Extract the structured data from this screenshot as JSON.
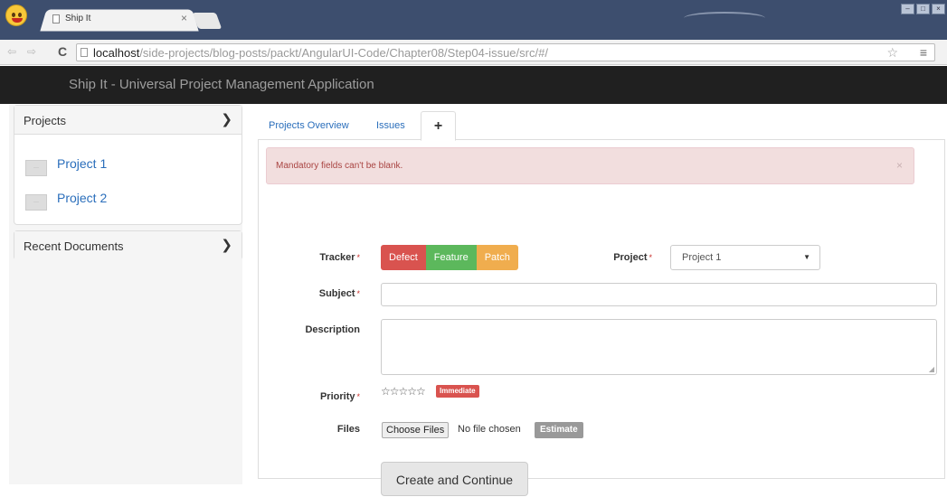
{
  "browser": {
    "tab_title": "Ship It",
    "tab_close": "×",
    "url_host": "localhost",
    "url_path": "/side-projects/blog-posts/packt/AngularUI-Code/Chapter08/Step04-issue/src/#/",
    "window_controls": [
      "–",
      "□",
      "×"
    ]
  },
  "app": {
    "brand": "Ship It - Universal Project Management Application"
  },
  "sidebar": {
    "projects_header": "Projects",
    "projects": [
      {
        "name": "Project 1"
      },
      {
        "name": "Project 2"
      }
    ],
    "recent_header": "Recent Documents"
  },
  "tabs": {
    "overview": "Projects Overview",
    "issues": "Issues",
    "new": "+"
  },
  "alert": {
    "message": "Mandatory fields can't be blank.",
    "close": "×"
  },
  "form": {
    "tracker_label": "Tracker",
    "required_mark": "*",
    "tracker_options": [
      "Defect",
      "Feature",
      "Patch"
    ],
    "project_label": "Project",
    "project_value": "Project 1",
    "subject_label": "Subject",
    "description_label": "Description",
    "priority_label": "Priority",
    "priority_stars": "☆☆☆☆☆",
    "priority_badge": "Immediate",
    "files_label": "Files",
    "choose_files": "Choose Files",
    "no_file": "No file chosen",
    "estimate": "Estimate",
    "submit": "Create and Continue"
  },
  "colors": {
    "appbar": "#202020",
    "defect": "#d9534f",
    "feature": "#5cb85c",
    "patch": "#f0ad4e",
    "link": "#2a6ebb",
    "alert_bg": "#f2dede"
  }
}
